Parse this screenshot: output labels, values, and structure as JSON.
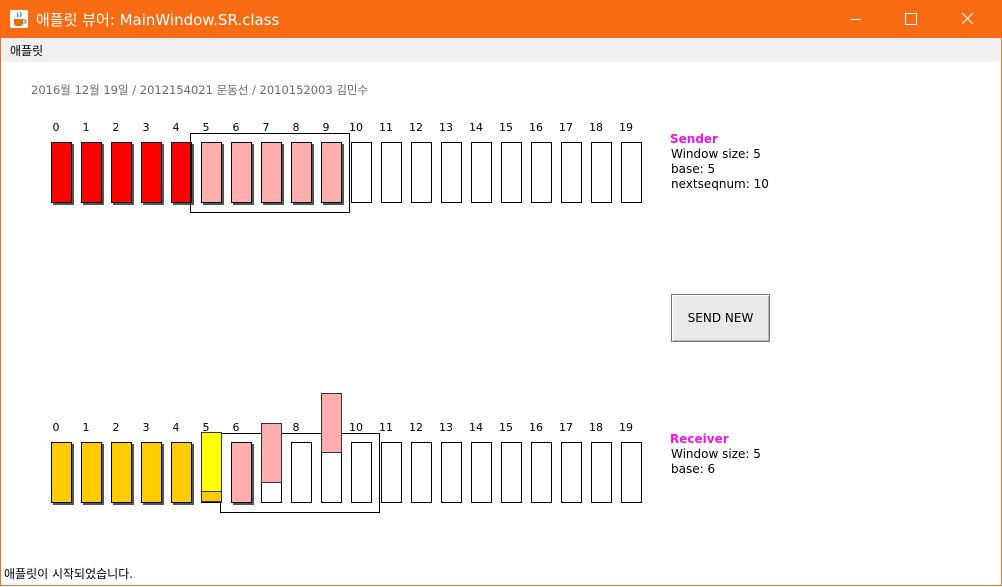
{
  "window": {
    "title": "애플릿 뷰어: MainWindow.SR.class",
    "menu": [
      "애플릿"
    ],
    "status": "애플릿이 시작되었습니다."
  },
  "header_info": "2016월 12월 19일 / 2012154021 문동선 / 2010152003 김민수",
  "sequence_numbers": [
    "0",
    "1",
    "2",
    "3",
    "4",
    "5",
    "6",
    "7",
    "8",
    "9",
    "10",
    "11",
    "12",
    "13",
    "14",
    "15",
    "16",
    "17",
    "18",
    "19"
  ],
  "sender": {
    "title": "Sender",
    "window_size": "Window size: 5",
    "base": "base: 5",
    "nextseqnum": "nextseqnum: 10",
    "acked": [
      0,
      1,
      2,
      3,
      4
    ],
    "sent_unacked": [
      5,
      6,
      7,
      8,
      9
    ],
    "window_start": 5,
    "window_size_value": 5
  },
  "receiver": {
    "title": "Receiver",
    "window_size": "Window size: 5",
    "base": "base: 6",
    "delivered": [
      0,
      1,
      2,
      3,
      4
    ],
    "received_buffered": [
      6
    ],
    "window_start": 6,
    "window_size_value": 5
  },
  "in_flight": [
    {
      "seq": 5,
      "color": "yellow",
      "note": "ack"
    },
    {
      "seq": 7,
      "color": "pink",
      "note": "packet"
    },
    {
      "seq": 9,
      "color": "pink",
      "note": "packet"
    }
  ],
  "buttons": {
    "send_new": "SEND NEW"
  },
  "colors": {
    "titlebar": "#f96c14",
    "acked": "#ff0000",
    "pending": "#ffaeae",
    "delivered": "#ffcc00",
    "ack_packet": "#ffff00",
    "panel_title": "#e619e6"
  },
  "icons": {
    "app": "java-coffee-icon"
  }
}
